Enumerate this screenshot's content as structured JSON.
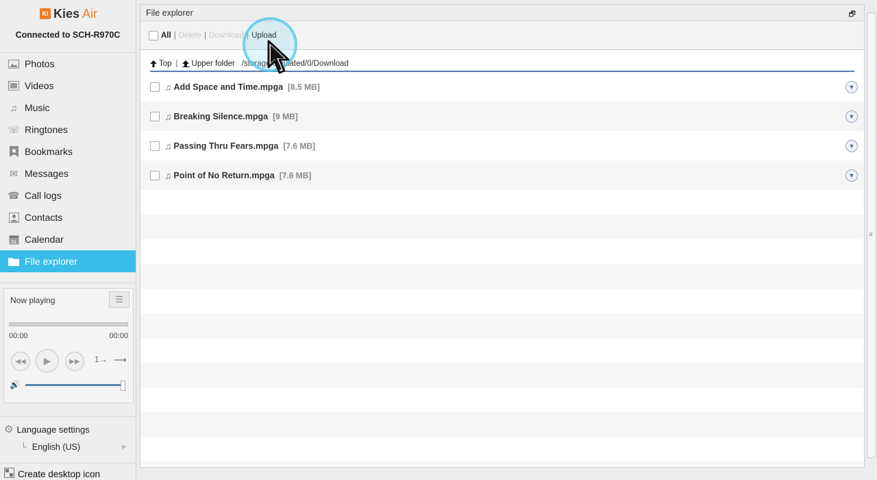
{
  "app": {
    "logo_badge": "KI",
    "logo_kies": "Kies",
    "logo_air": "Air",
    "connected": "Connected to SCH-R970C"
  },
  "sidebar": {
    "items": [
      {
        "label": "Photos",
        "icon": "photo-icon"
      },
      {
        "label": "Videos",
        "icon": "film-icon"
      },
      {
        "label": "Music",
        "icon": "music-note-icon"
      },
      {
        "label": "Ringtones",
        "icon": "phone-ring-icon"
      },
      {
        "label": "Bookmarks",
        "icon": "star-icon"
      },
      {
        "label": "Messages",
        "icon": "envelope-icon"
      },
      {
        "label": "Call logs",
        "icon": "call-log-icon"
      },
      {
        "label": "Contacts",
        "icon": "contact-icon"
      },
      {
        "label": "Calendar",
        "icon": "calendar-icon"
      },
      {
        "label": "File explorer",
        "icon": "folder-icon",
        "active": true
      }
    ],
    "calendar_day": "31"
  },
  "player": {
    "label": "Now playing",
    "time_current": "00:00",
    "time_total": "00:00",
    "repeat_label": "1",
    "progress": 0,
    "volume": 0.97
  },
  "language": {
    "label": "Language settings",
    "value": "English (US)"
  },
  "desktop_icon": {
    "label": "Create desktop icon"
  },
  "panel": {
    "title": "File explorer"
  },
  "toolbar": {
    "all": "All",
    "delete": "Delete",
    "download": "Download",
    "upload": "Upload"
  },
  "path": {
    "top": "Top",
    "upper": "Upper folder",
    "current": "/storage/emulated/0/Download"
  },
  "files": [
    {
      "name": "Add Space and Time.mpga",
      "size": "[8.5 MB]"
    },
    {
      "name": "Breaking Silence.mpga",
      "size": "[9 MB]"
    },
    {
      "name": "Passing Thru Fears.mpga",
      "size": "[7.6 MB]"
    },
    {
      "name": "Point of No Return.mpga",
      "size": "[7.6 MB]"
    }
  ],
  "colors": {
    "accent": "#38bde8",
    "brand_orange": "#f07a20",
    "path_underline": "#5b7ab0"
  }
}
